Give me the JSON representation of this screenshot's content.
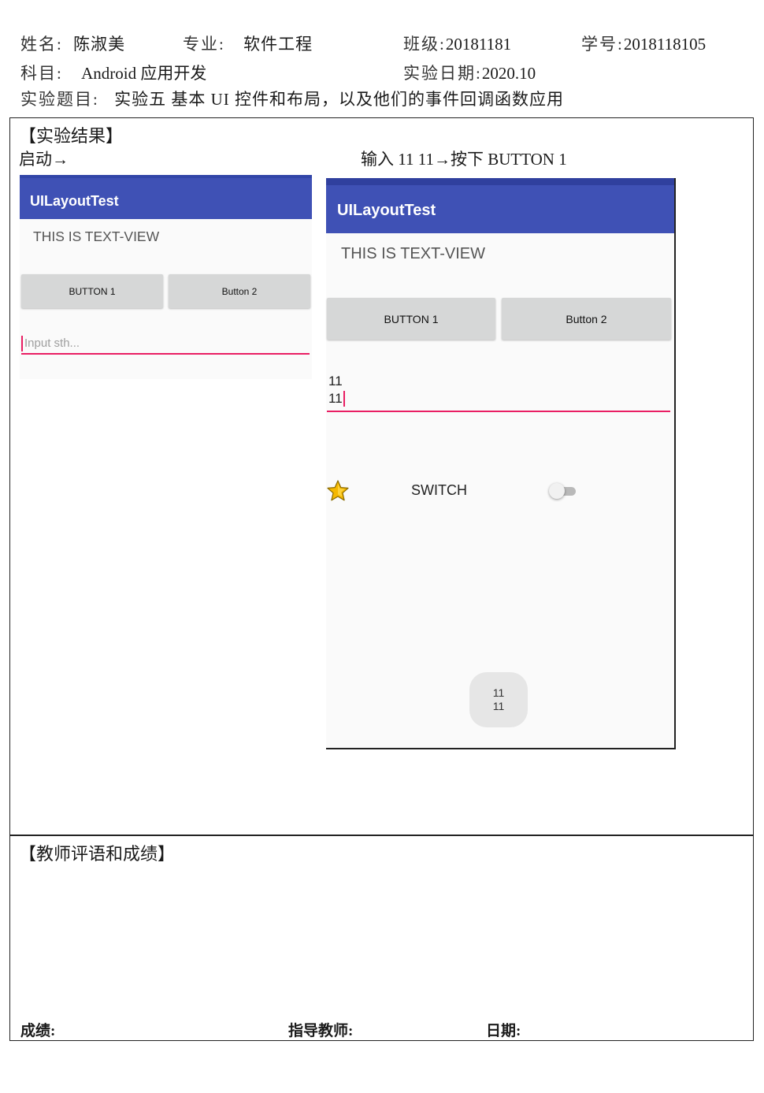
{
  "header": {
    "name_label": "姓名:",
    "name_value": "陈淑美",
    "major_label": "专业:",
    "major_value": "软件工程",
    "class_label": "班级:",
    "class_value": "20181181",
    "id_label": "学号:",
    "id_value": "2018118105",
    "subject_label": "科目:",
    "subject_value": "Android 应用开发",
    "date_label": "实验日期:",
    "date_value": "2020.10",
    "topic_label": "实验题目:",
    "topic_value": "实验五 基本 UI 控件和布局，以及他们的事件回调函数应用"
  },
  "results": {
    "heading": "【实验结果】",
    "caption_left": "启动→",
    "caption_right": "输入 11 11→按下 BUTTON 1"
  },
  "screen1": {
    "app_title": "UILayoutTest",
    "text_view": "THIS IS TEXT-VIEW",
    "button1": "BUTTON 1",
    "button2": "Button 2",
    "input_placeholder": "Input sth..."
  },
  "screen2": {
    "app_title": "UILayoutTest",
    "text_view": "THIS IS TEXT-VIEW",
    "button1": "BUTTON 1",
    "button2": "Button 2",
    "input_line1": "11",
    "input_line2": "11",
    "switch_label": "SWITCH",
    "toast_line1": "11",
    "toast_line2": "11"
  },
  "colors": {
    "app_bar": "#3f51b5",
    "input_underline": "#e91e63",
    "button_bg": "#d6d7d7",
    "star": "#f5b800"
  },
  "comments": {
    "heading": "【教师评语和成绩】",
    "grade_label": "成绩:",
    "teacher_label": "指导教师:",
    "date_label": "日期:"
  }
}
